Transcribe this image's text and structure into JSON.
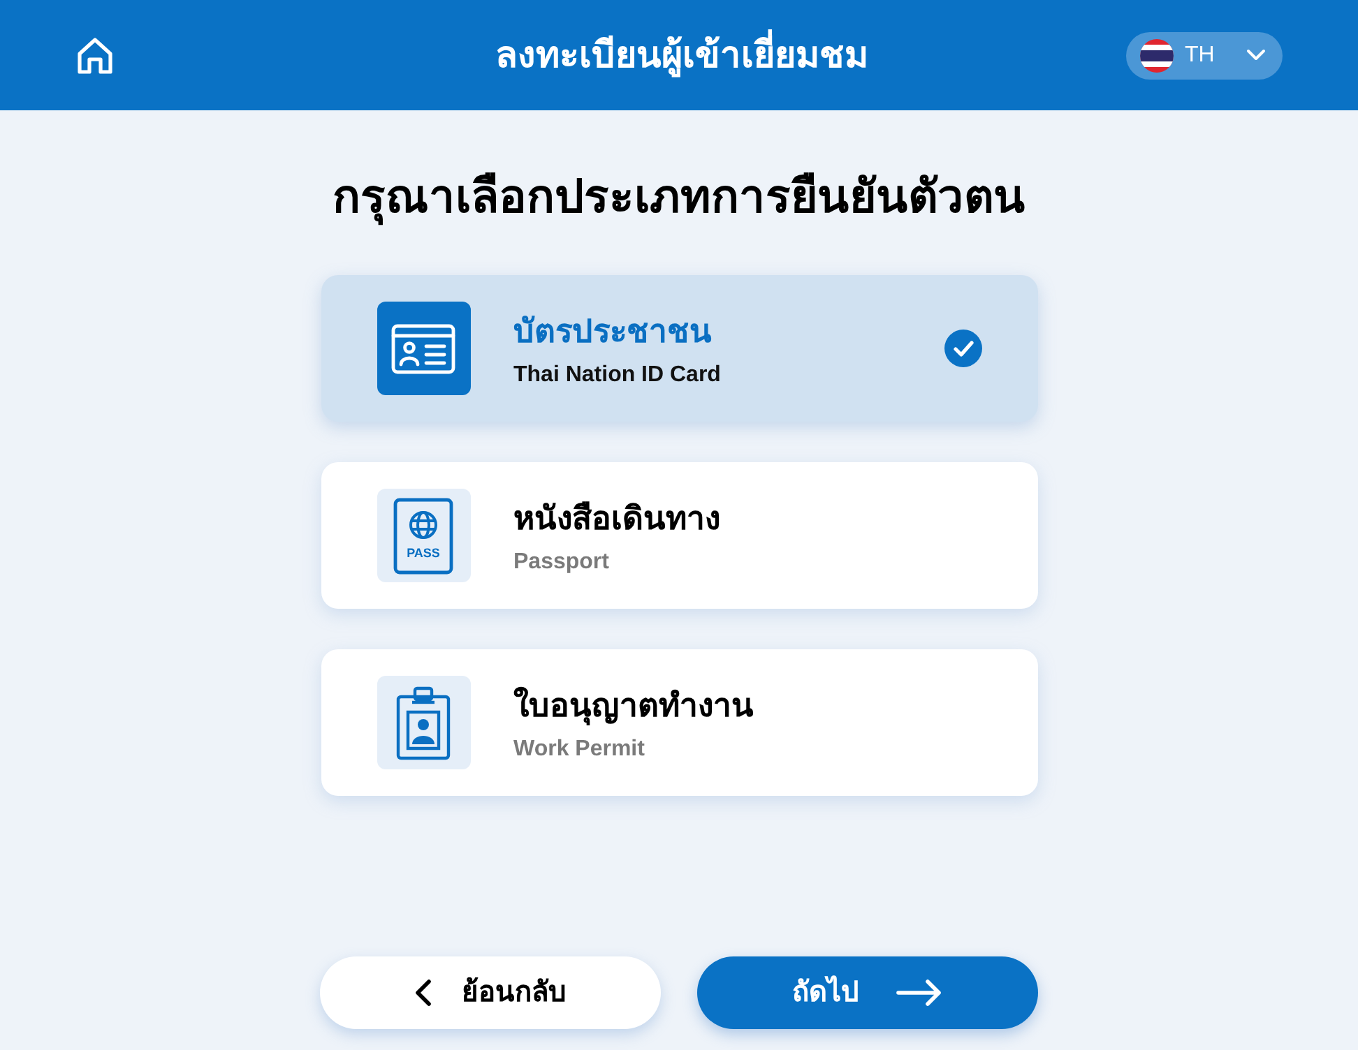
{
  "header": {
    "title": "ลงทะเบียนผู้เข้าเยี่ยมชม",
    "language": {
      "code": "TH"
    }
  },
  "heading": "กรุณาเลือกประเภทการยืนยันตัวตน",
  "options": [
    {
      "kind": "id_card",
      "title": "บัตรประชาชน",
      "subtitle": "Thai Nation ID Card",
      "selected": true
    },
    {
      "kind": "passport",
      "title": "หนังสือเดินทาง",
      "subtitle": "Passport",
      "icon_text": "PASS",
      "selected": false
    },
    {
      "kind": "work_permit",
      "title": "ใบอนุญาตทำงาน",
      "subtitle": "Work Permit",
      "selected": false
    }
  ],
  "buttons": [
    {
      "kind": "back",
      "label": "ย้อนกลับ"
    },
    {
      "kind": "next",
      "label": "ถัดไป"
    }
  ]
}
